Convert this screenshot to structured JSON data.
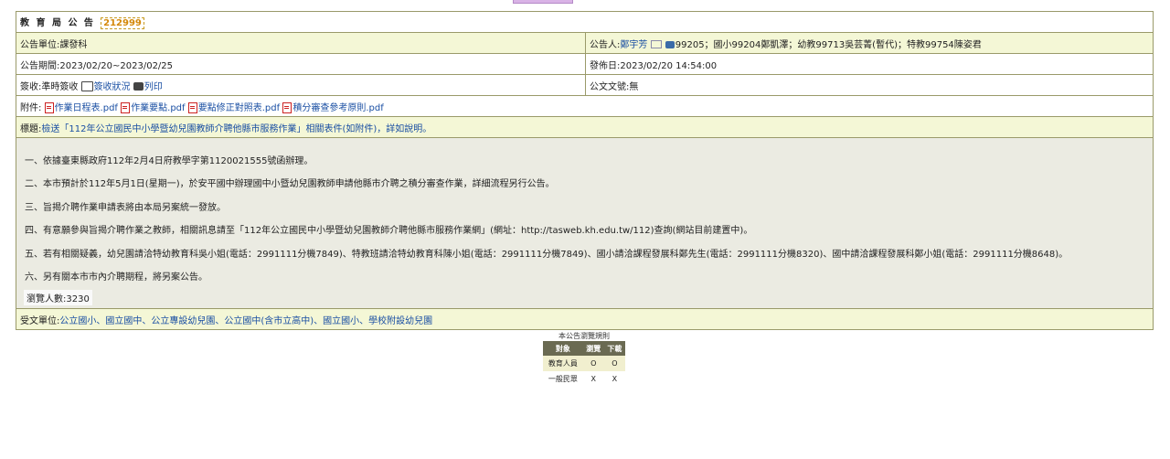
{
  "header": {
    "title": "教 育 局 公 告",
    "announcement_id": "212999"
  },
  "info": {
    "unit": "公告單位:課發科",
    "announcer_label": "公告人:",
    "announcer_name": "鄭宇芳",
    "announcer_ext": "99205；國小99204鄭凱澤；幼教99713吳芸菁(暫代)；特教99754陳姿君",
    "period": "公告期間:2023/02/20~2023/02/25",
    "publish_date": "發佈日:2023/02/20 14:54:00",
    "sign_label": "簽收:準時簽收",
    "sign_status_link": "簽收狀況",
    "print_link": "列印",
    "doc_number": "公文文號:無"
  },
  "attachments": {
    "label": "附件:",
    "files": [
      "作業日程表.pdf",
      "作業要點.pdf",
      "要點修正對照表.pdf",
      "積分審查參考原則.pdf"
    ]
  },
  "subject": {
    "label": "標題:",
    "text": "檢送「112年公立國民中小學暨幼兒園教師介聘他縣市服務作業」相關表件(如附件)，詳如說明。"
  },
  "body": {
    "lines": [
      "一、依據臺東縣政府112年2月4日府教學字第1120021555號函辦理。",
      "二、本市預計於112年5月1日(星期一)，於安平國中辦理國中小暨幼兒園教師申請他縣市介聘之積分審查作業，詳細流程另行公告。",
      "三、旨揭介聘作業申請表將由本局另案統一發放。",
      "四、有意願參與旨揭介聘作業之教師，相關訊息請至「112年公立國民中小學暨幼兒園教師介聘他縣市服務作業網」(網址：http://tasweb.kh.edu.tw/112)查詢(網站目前建置中)。",
      "五、若有相關疑義，幼兒園請洽特幼教育科吳小姐(電話：2991111分機7849)、特教班請洽特幼教育科陳小姐(電話：2991111分機7849)、國小請洽課程發展科鄭先生(電話：2991111分機8320)、國中請洽課程發展科鄭小姐(電話：2991111分機8648)。",
      "六、另有關本市市內介聘期程，將另案公告。"
    ],
    "views": "瀏覽人數:3230"
  },
  "recipients": {
    "label": "受文單位:",
    "text": "公立國小、國立國中、公立專設幼兒園、公立國中(含市立高中)、國立國小、學校附設幼兒園"
  },
  "rules": {
    "title": "本公告瀏覽規則",
    "headers": [
      "對象",
      "瀏覽",
      "下載"
    ],
    "rows": [
      [
        "教育人員",
        "O",
        "O"
      ],
      [
        "一般民眾",
        "X",
        "X"
      ]
    ]
  }
}
